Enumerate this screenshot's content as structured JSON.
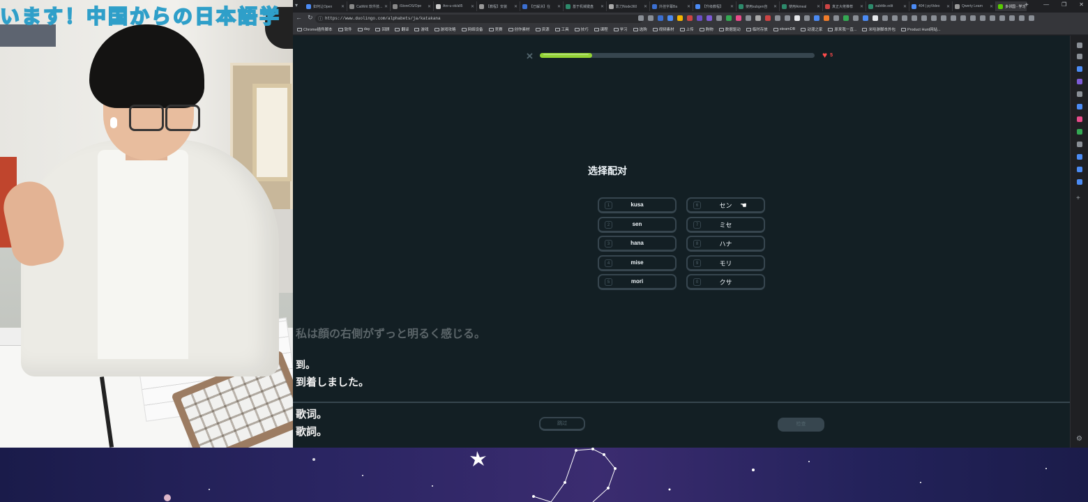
{
  "overlay": {
    "banner_text": "います！中国からの日本語学"
  },
  "browser": {
    "tabs": [
      {
        "label": "如何让Open",
        "color": "#4b8bf4"
      },
      {
        "label": "CatWrit 软件技...",
        "color": "#888"
      },
      {
        "label": "iStoreOS/Ope",
        "color": "#888"
      },
      {
        "label": "Are-u-ok/all5",
        "color": "#ccc"
      },
      {
        "label": "【教程】安装",
        "color": "#999"
      },
      {
        "label": "【已解决】在",
        "color": "#3b6fd1"
      },
      {
        "label": "基于机械键盘",
        "color": "#2d8a6b"
      },
      {
        "label": "影刀Node360",
        "color": "#aaa"
      },
      {
        "label": "外挂字幕Ba",
        "color": "#3b6fd1"
      },
      {
        "label": "【升级教程】",
        "color": "#4b8bf4"
      },
      {
        "label": "使用subgen自",
        "color": "#2d8a6b"
      },
      {
        "label": "使用Aimeal",
        "color": "#2d8a6b"
      },
      {
        "label": "真正大佬推荐",
        "color": "#c44"
      },
      {
        "label": "subtitle.edit",
        "color": "#2d8a6b"
      },
      {
        "label": "404 | pyVideo",
        "color": "#4b8bf4"
      },
      {
        "label": "Qwerty Learn",
        "color": "#999"
      },
      {
        "label": "多邻国 - 学习",
        "color": "#58cc02",
        "active": true
      }
    ],
    "url": "https://www.duolingo.com/alphabets/ja/katakana",
    "bookmarks": [
      {
        "label": "Chrome插件脚本"
      },
      {
        "label": "软件"
      },
      {
        "label": "day"
      },
      {
        "label": "回顾"
      },
      {
        "label": "翻译"
      },
      {
        "label": "游戏"
      },
      {
        "label": "游戏攻略"
      },
      {
        "label": "网络设备"
      },
      {
        "label": "竞赛"
      },
      {
        "label": "创作素材"
      },
      {
        "label": "资源"
      },
      {
        "label": "工具"
      },
      {
        "label": "技巧"
      },
      {
        "label": "课程"
      },
      {
        "label": "学习"
      },
      {
        "label": "选购"
      },
      {
        "label": "视频素材"
      },
      {
        "label": "上传"
      },
      {
        "label": "购物"
      },
      {
        "label": "数据驱动"
      },
      {
        "label": "临时存放"
      },
      {
        "label": "steamDB"
      },
      {
        "label": "动漫之家"
      },
      {
        "label": "原来我一直..."
      },
      {
        "label": "米哈游脚本外包"
      },
      {
        "label": "Product Hunt网站..."
      }
    ]
  },
  "lesson": {
    "hearts": "5",
    "progress_fraction": 0.19,
    "prompt": "选择配对",
    "left_options": [
      {
        "num": "1",
        "label": "kusa"
      },
      {
        "num": "2",
        "label": "sen"
      },
      {
        "num": "3",
        "label": "hana"
      },
      {
        "num": "4",
        "label": "mise"
      },
      {
        "num": "5",
        "label": "mori"
      }
    ],
    "right_options": [
      {
        "num": "6",
        "label": "セン"
      },
      {
        "num": "7",
        "label": "ミセ"
      },
      {
        "num": "8",
        "label": "ハナ"
      },
      {
        "num": "9",
        "label": "モリ"
      },
      {
        "num": "0",
        "label": "クサ"
      }
    ],
    "skip_label": "跳过",
    "check_label": "检查"
  },
  "subtitles": {
    "line1": "私は顔の右側がずっと明るく感じる。",
    "line2": "到。",
    "line3": "到着しました。",
    "line4": "歌词。",
    "line5": "歌詞。"
  },
  "colors": {
    "page_bg": "#131f24",
    "border": "#37464f",
    "progress_green": "#93d334",
    "heart_red": "#ff4b4b"
  }
}
